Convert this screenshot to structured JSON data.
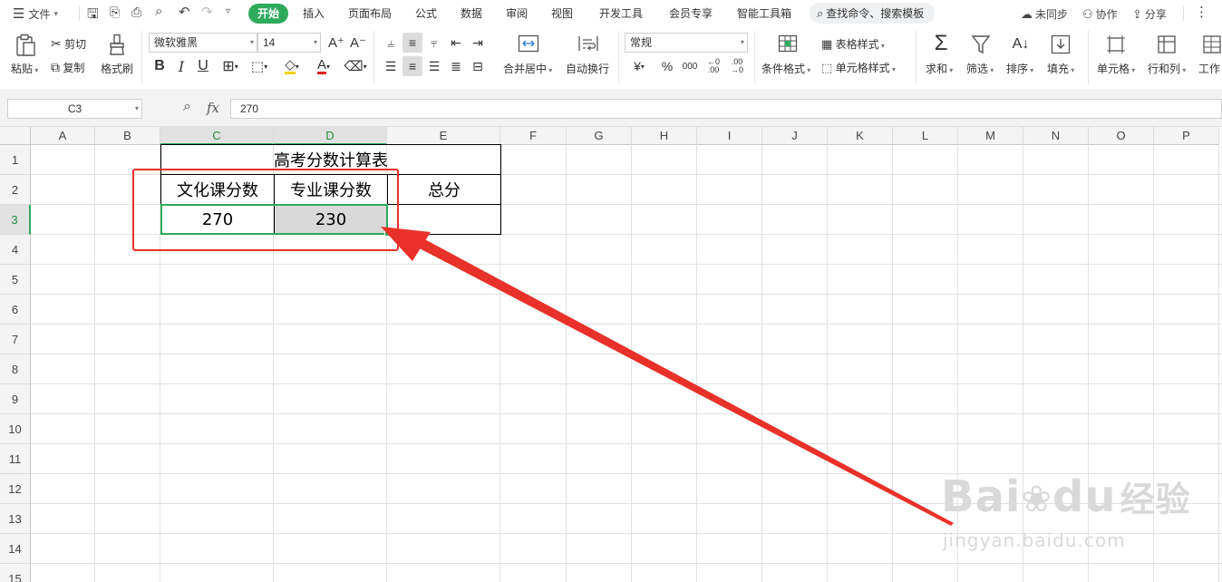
{
  "titlebar": {
    "menu_icon": "hamburger-icon",
    "file_label": "文件",
    "tabs": [
      "开始",
      "插入",
      "页面布局",
      "公式",
      "数据",
      "审阅",
      "视图",
      "开发工具",
      "会员专享",
      "智能工具箱"
    ],
    "search_placeholder": "查找命令、搜索模板",
    "unsync_label": "未同步",
    "collab_label": "协作",
    "share_label": "分享"
  },
  "ribbon": {
    "paste": "粘贴",
    "cut": "剪切",
    "copy": "复制",
    "format_painter": "格式刷",
    "font_name": "微软雅黑",
    "font_size": "14",
    "bold": "B",
    "italic": "I",
    "underline": "U",
    "merge_center": "合并居中",
    "auto_wrap": "自动换行",
    "number_format": "常规",
    "currency": "¥",
    "percent": "%",
    "thousand": "000",
    "cond_format": "条件格式",
    "table_style": "表格样式",
    "cell_style": "单元格样式",
    "sum": "求和",
    "filter": "筛选",
    "sort": "排序",
    "fill": "填充",
    "cell": "单元格",
    "row_col": "行和列",
    "worksheet": "工作"
  },
  "formula_bar": {
    "cell_ref": "C3",
    "fx": "fx",
    "value": "270"
  },
  "sheet": {
    "columns": [
      "A",
      "B",
      "C",
      "D",
      "E",
      "F",
      "G",
      "H",
      "I",
      "J",
      "K",
      "L",
      "M",
      "N",
      "O",
      "P"
    ],
    "rows": [
      "1",
      "2",
      "3",
      "4",
      "5",
      "6",
      "7",
      "8",
      "9",
      "10",
      "11",
      "12",
      "13",
      "14",
      "15"
    ],
    "table": {
      "title": "高考分数计算表",
      "headers": [
        "文化课分数",
        "专业课分数",
        "总分"
      ],
      "values": [
        "270",
        "230",
        ""
      ]
    }
  },
  "watermark": {
    "brand": "Bai",
    "brand2": "du",
    "brand3": "经验",
    "url": "jingyan.baidu.com"
  },
  "colors": {
    "accent": "#2eaa5c",
    "annotation": "#e8312a",
    "selected_fill": "#d9d9d9"
  }
}
